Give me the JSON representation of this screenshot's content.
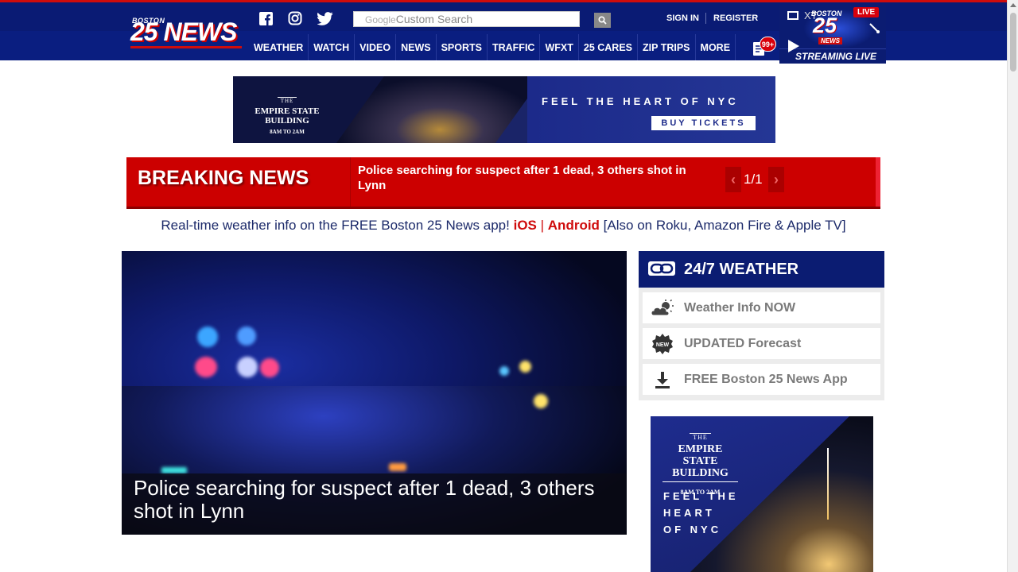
{
  "header": {
    "logo_top": "BOSTON",
    "logo_main": "25 NEWS",
    "search_brand": "Google",
    "search_placeholder": "Custom Search",
    "sign_in": "SIGN IN",
    "register": "REGISTER",
    "nav": [
      "WEATHER",
      "WATCH",
      "VIDEO",
      "NEWS",
      "SPORTS",
      "TRAFFIC",
      "WFXT",
      "25 CARES",
      "ZIP TRIPS",
      "MORE"
    ],
    "notifications_count": "99+",
    "live_player": {
      "xt": "XT",
      "station_top": "BOSTON",
      "station_num": "25",
      "station_news": "NEWS",
      "live_badge": "LIVE",
      "streaming": "STREAMING LIVE"
    }
  },
  "ad_top": {
    "the": "THE",
    "name": "EMPIRE STATE BUILDING",
    "hours": "8AM TO 2AM",
    "tagline": "FEEL THE HEART OF NYC",
    "cta": "BUY TICKETS"
  },
  "breaking": {
    "label": "BREAKING NEWS",
    "headline": "Police searching for suspect after 1 dead, 3 others shot in Lynn",
    "counter": "1/1"
  },
  "promo": {
    "text": "Real-time weather info on the FREE Boston 25 News app!",
    "ios": "iOS",
    "sep": "|",
    "android": "Android",
    "extra": "[Also on Roku, Amazon Fire & Apple TV]"
  },
  "hero": {
    "caption": "Police searching for suspect after 1 dead, 3 others shot in Lynn"
  },
  "weather": {
    "title": "24/7 WEATHER",
    "items": [
      {
        "label": "Weather Info NOW",
        "icon": "partly-cloudy-icon"
      },
      {
        "label": "UPDATED Forecast",
        "icon": "new-badge-icon"
      },
      {
        "label": "FREE Boston 25 News App",
        "icon": "download-icon"
      }
    ]
  },
  "ad_side": {
    "the": "THE",
    "name": "EMPIRE STATE BUILDING",
    "hours": "8AM TO 2AM",
    "tagline_1": "FEEL THE",
    "tagline_2": "HEART",
    "tagline_3": "OF NYC"
  },
  "colors": {
    "brand_blue": "#0a1e80",
    "brand_red": "#cc0000"
  }
}
